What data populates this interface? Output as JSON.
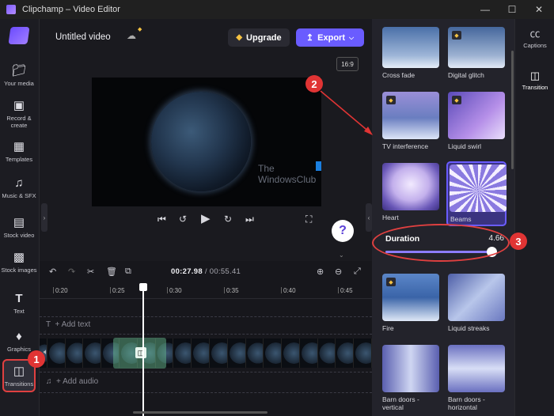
{
  "window": {
    "title": "Clipchamp – Video Editor"
  },
  "topbar": {
    "video_title": "Untitled video",
    "upgrade_label": "Upgrade",
    "export_label": "Export",
    "aspect_ratio": "16:9"
  },
  "nav": [
    {
      "label": "Your media",
      "icon": "folder-icon"
    },
    {
      "label": "Record & create",
      "icon": "camera-icon"
    },
    {
      "label": "Templates",
      "icon": "templates-icon"
    },
    {
      "label": "Music & SFX",
      "icon": "music-icon"
    },
    {
      "label": "Stock video",
      "icon": "film-icon"
    },
    {
      "label": "Stock images",
      "icon": "image-icon"
    },
    {
      "label": "Text",
      "icon": "text-icon"
    },
    {
      "label": "Graphics",
      "icon": "graphics-icon"
    },
    {
      "label": "Transitions",
      "icon": "transitions-icon"
    }
  ],
  "preview": {
    "watermark_line1": "The",
    "watermark_line2": "WindowsClub"
  },
  "timeline": {
    "current_time": "00:27.98",
    "total_time": "/ 00:55.41",
    "ticks": [
      "0:20",
      "0:25",
      "0:30",
      "0:35",
      "0:40",
      "0:45"
    ],
    "add_text": "Add text",
    "add_audio": "Add audio"
  },
  "transitions": [
    {
      "label": "Cross fade",
      "premium": false
    },
    {
      "label": "Digital glitch",
      "premium": true
    },
    {
      "label": "TV interference",
      "premium": true
    },
    {
      "label": "Liquid swirl",
      "premium": true
    },
    {
      "label": "Heart",
      "premium": false
    },
    {
      "label": "Beams",
      "premium": false,
      "selected": true
    },
    {
      "label": "Fire",
      "premium": true
    },
    {
      "label": "Liquid streaks",
      "premium": false
    },
    {
      "label": "Barn doors - vertical",
      "premium": false
    },
    {
      "label": "Barn doors - horizontal",
      "premium": false
    }
  ],
  "duration": {
    "label": "Duration",
    "value": "4.66",
    "fraction": 0.96
  },
  "rightrail": {
    "captions": "Captions",
    "transition": "Transition"
  },
  "annotations": [
    "1",
    "2",
    "3"
  ],
  "colors": {
    "accent": "#6a5cff",
    "annotation": "#e03434",
    "premium": "#f5c242"
  }
}
